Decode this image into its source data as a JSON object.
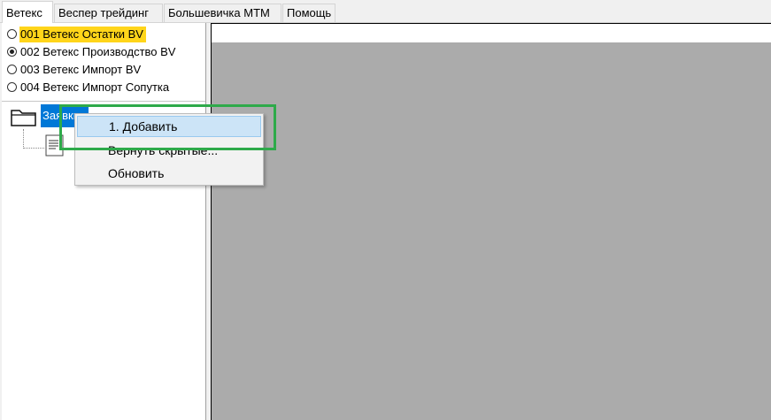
{
  "tabs": [
    {
      "label": "Ветекс",
      "active": true
    },
    {
      "label": "Веспер трейдинг",
      "active": false
    },
    {
      "label": "Большевичка МТМ",
      "active": false
    },
    {
      "label": "Помощь",
      "active": false
    }
  ],
  "radio_options": [
    {
      "label": "001 Ветекс Остатки BV",
      "checked": false,
      "highlighted": true
    },
    {
      "label": "002 Ветекс Производство BV",
      "checked": true,
      "highlighted": false
    },
    {
      "label": "003 Ветекс Импорт BV",
      "checked": false,
      "highlighted": false
    },
    {
      "label": "004 Ветекс Импорт Сопутка",
      "checked": false,
      "highlighted": false
    }
  ],
  "tree": {
    "selected_node_label": "Заявки"
  },
  "context_menu": {
    "items": [
      {
        "label": "1. Добавить",
        "hovered": true
      },
      {
        "label": "Вернуть скрытые...",
        "hovered": false
      },
      {
        "label": "Обновить",
        "hovered": false
      }
    ]
  },
  "colors": {
    "selection": "#0078d7",
    "highlight": "#ffd51a",
    "annotation_box": "#2eaa4a",
    "workspace": "#ababab"
  }
}
